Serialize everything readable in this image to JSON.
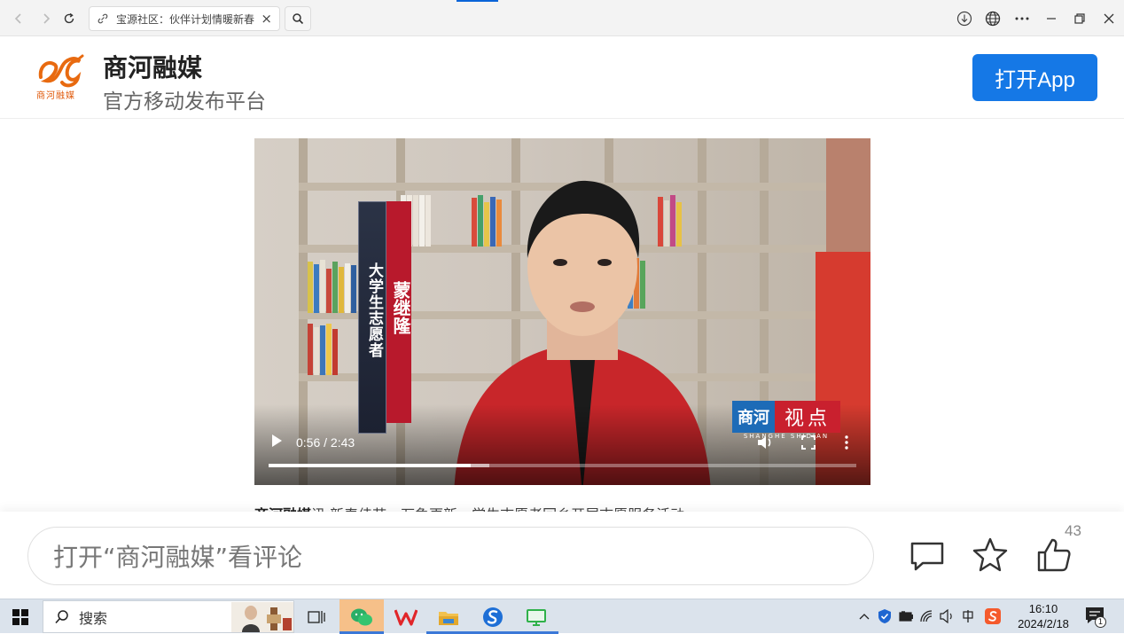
{
  "browser": {
    "tab_title": "宝源社区：伙伴计划情暖新春"
  },
  "site": {
    "logo_text": "商河融媒",
    "name": "商河融媒",
    "subtitle": "官方移动发布平台",
    "open_app": "打开App"
  },
  "video": {
    "caption_role": "大学生志愿者",
    "caption_name": "蒙继隆",
    "channel": {
      "part1": "商河",
      "part2": "视点",
      "part3": "SHANGHE SHIDIAN"
    },
    "time": "0:56 / 2:43",
    "progress": 0.344,
    "buffered": 0.375
  },
  "article": {
    "highlight": "商河融媒",
    "text": "讯 新春佳节，万象更新，学生志愿者回乡开展志愿服务活动"
  },
  "comment_bar": {
    "placeholder": "打开“商河融媒”看评论",
    "like_count": "43"
  },
  "taskbar": {
    "search_label": "搜索",
    "time": "16:10",
    "date": "2024/2/18",
    "notifications": "1"
  },
  "colors": {
    "accent": "#1578e6",
    "brand_orange": "#e05a0b",
    "caption_red": "#b8192c"
  }
}
